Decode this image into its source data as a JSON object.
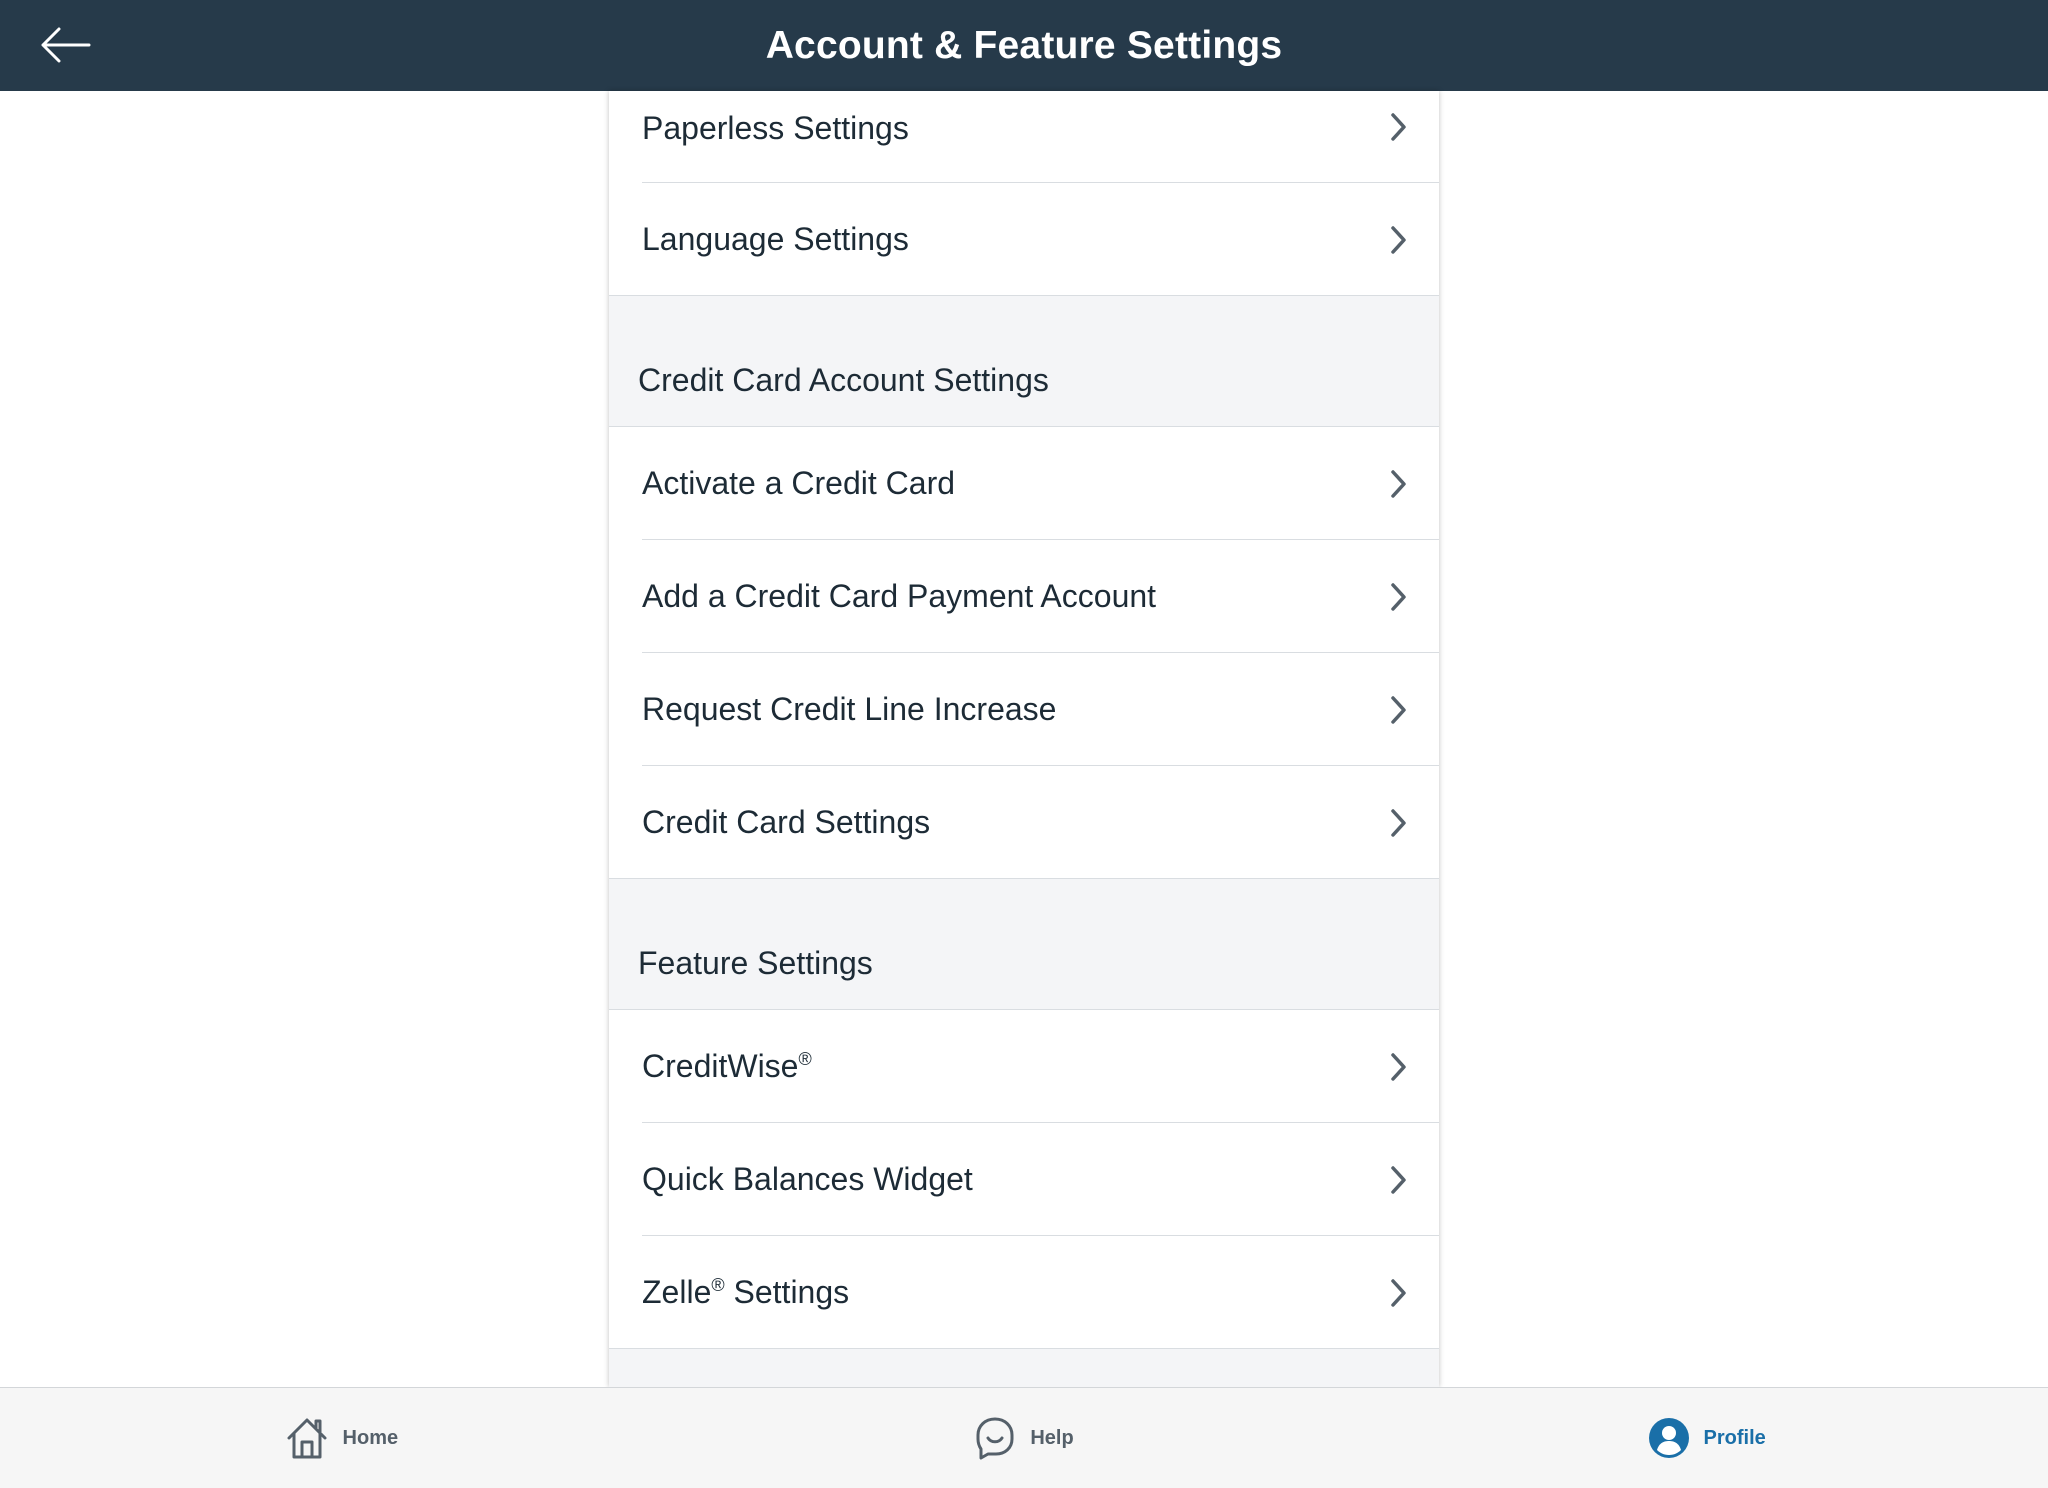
{
  "header": {
    "title": "Account & Feature Settings",
    "back_icon": "arrow-left-icon"
  },
  "groups": [
    {
      "section_title": "",
      "items": [
        {
          "label": "Paperless Settings"
        },
        {
          "label": "Language Settings"
        }
      ]
    },
    {
      "section_title": "Credit Card Account Settings",
      "items": [
        {
          "label": "Activate a Credit Card"
        },
        {
          "label": "Add a Credit Card Payment Account"
        },
        {
          "label": "Request Credit Line Increase"
        },
        {
          "label": "Credit Card Settings"
        }
      ]
    },
    {
      "section_title": "Feature Settings",
      "items": [
        {
          "label": "CreditWise",
          "mark": "®"
        },
        {
          "label": "Quick Balances Widget"
        },
        {
          "label": "Zelle",
          "mark": "®",
          "suffix": " Settings"
        }
      ]
    }
  ],
  "tabbar": {
    "tabs": [
      {
        "label": "Home",
        "icon": "home-icon",
        "active": false
      },
      {
        "label": "Help",
        "icon": "chat-bubble-icon",
        "active": false
      },
      {
        "label": "Profile",
        "icon": "profile-icon",
        "active": true
      }
    ]
  },
  "colors": {
    "header_bg": "#263a4a",
    "section_bg": "#f4f5f7",
    "accent": "#1a6fa8",
    "text": "#1d2b36",
    "chevron": "#55606a"
  }
}
